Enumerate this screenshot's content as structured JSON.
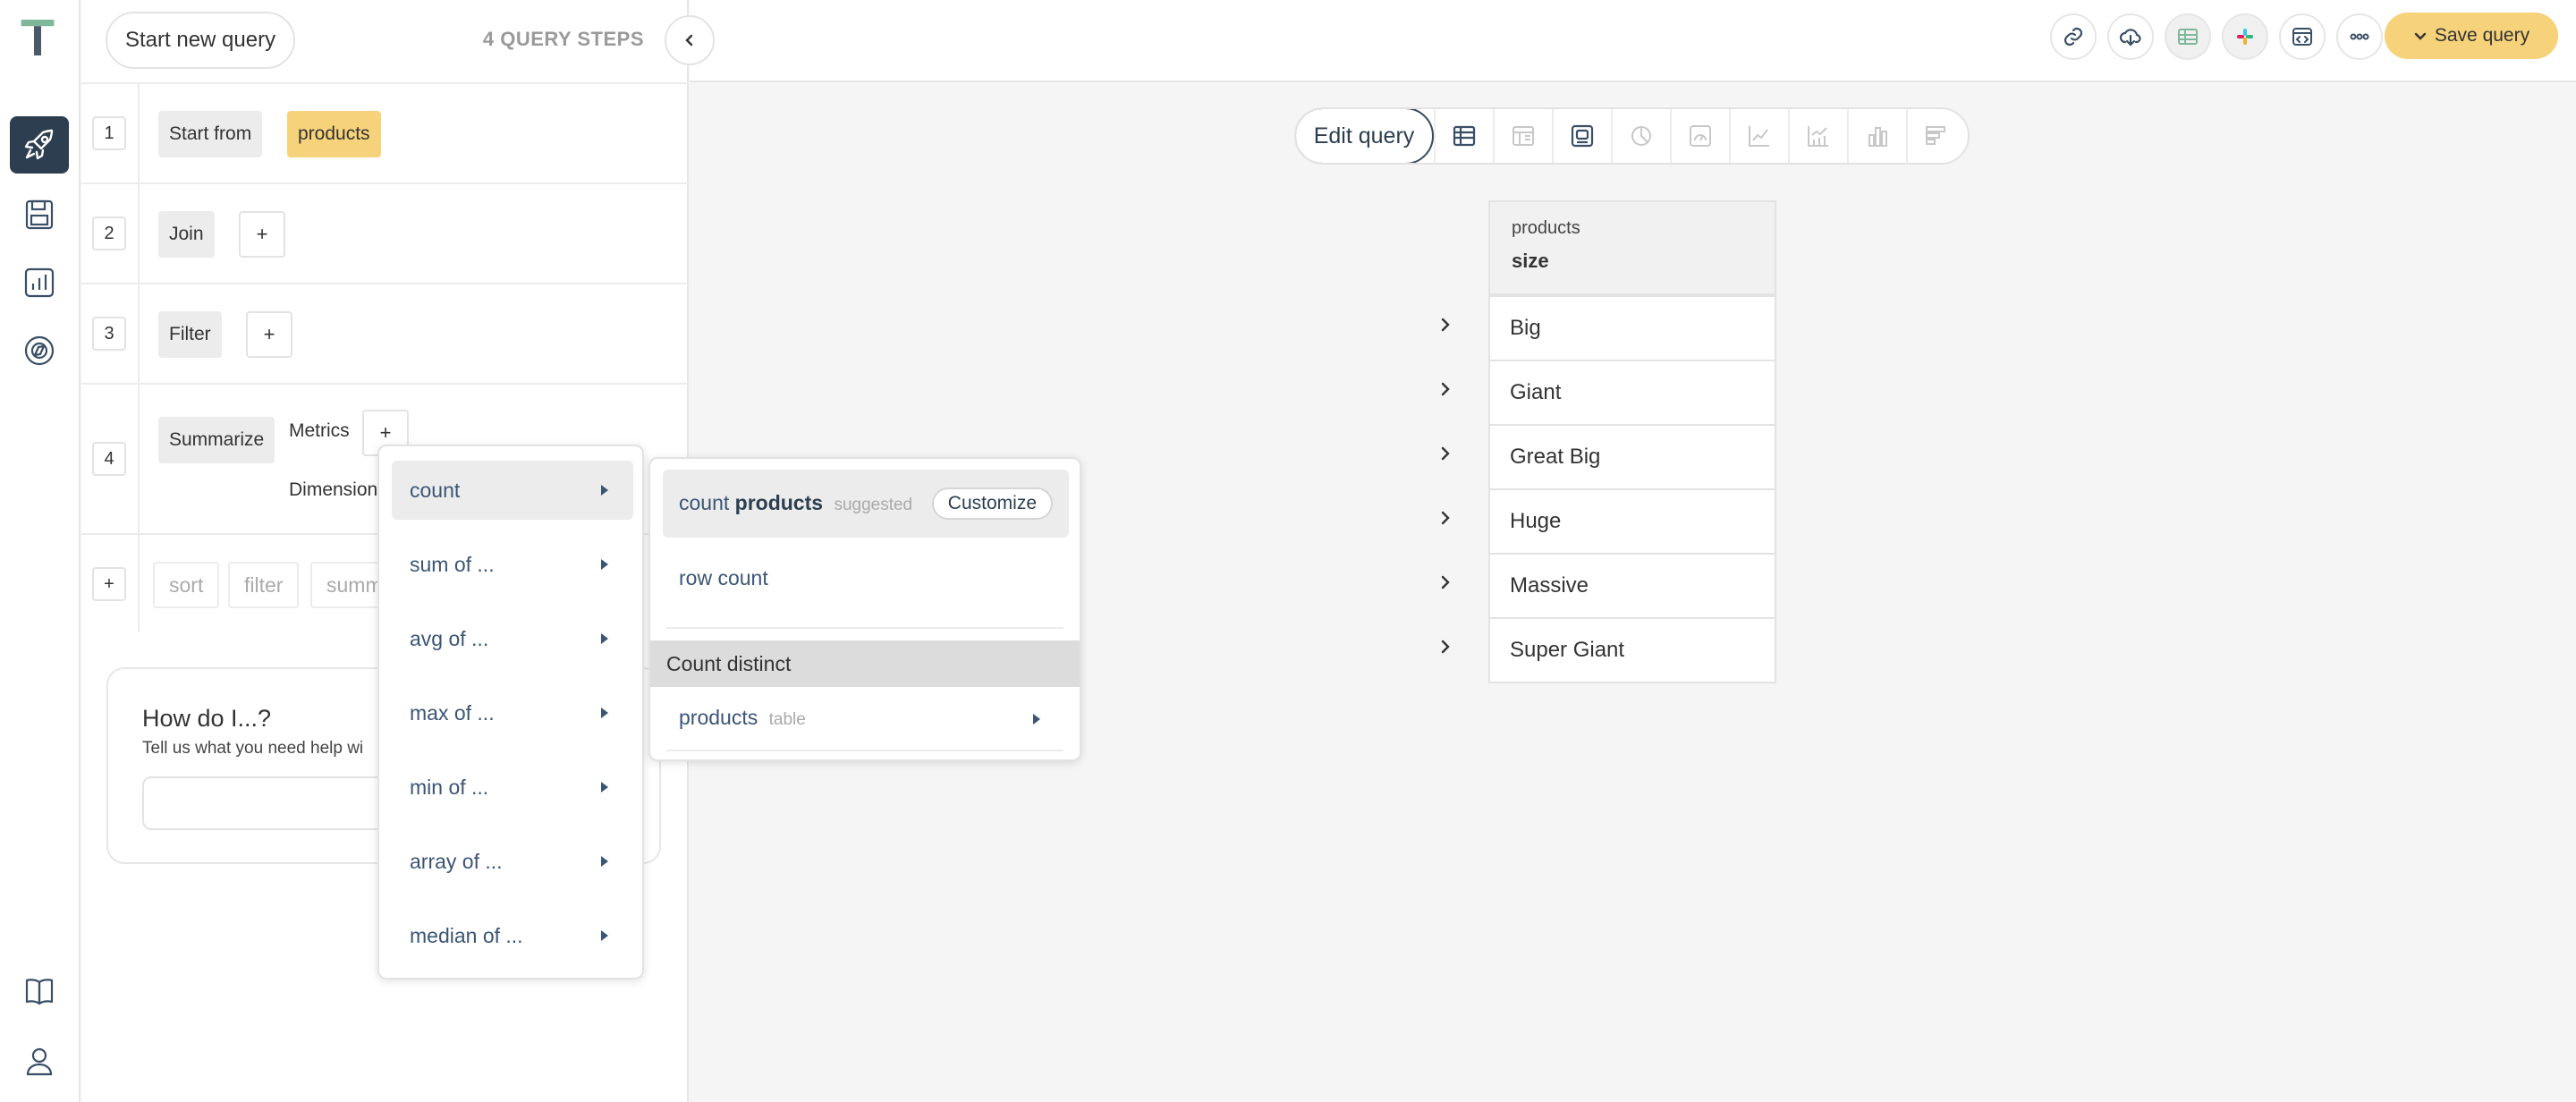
{
  "header": {
    "start_new_query": "Start new query",
    "query_steps": "4 QUERY STEPS",
    "save_query": "Save query"
  },
  "steps": [
    {
      "num": "1",
      "label": "Start from",
      "value": "products"
    },
    {
      "num": "2",
      "label": "Join"
    },
    {
      "num": "3",
      "label": "Filter"
    },
    {
      "num": "4",
      "label": "Summarize",
      "metrics_label": "Metrics",
      "dimensions_label": "Dimensions"
    }
  ],
  "add_step": {
    "plus": "+",
    "sort": "sort",
    "filter": "filter",
    "summarize": "summ"
  },
  "help": {
    "title": "How do I...?",
    "subtitle": "Tell us what you need help wi"
  },
  "view_toolbar": {
    "edit_query": "Edit query"
  },
  "result_table": {
    "table_name": "products",
    "column": "size",
    "rows": [
      "Big",
      "Giant",
      "Great Big",
      "Huge",
      "Massive",
      "Super Giant"
    ]
  },
  "metric_menu": {
    "items": [
      "count",
      "sum of ...",
      "avg of ...",
      "max of ...",
      "min of ...",
      "array of ...",
      "median of ..."
    ]
  },
  "count_menu": {
    "count_prefix": "count",
    "count_table": "products",
    "suggested": "suggested",
    "customize": "Customize",
    "row_count": "row count",
    "section": "Count distinct",
    "table_item": "products",
    "table_tag": "table"
  },
  "colors": {
    "accent_yellow": "#f6d27a",
    "nav_active": "#2c3e50",
    "menu_text": "#3b5576",
    "logo_green": "#7fb79a"
  }
}
